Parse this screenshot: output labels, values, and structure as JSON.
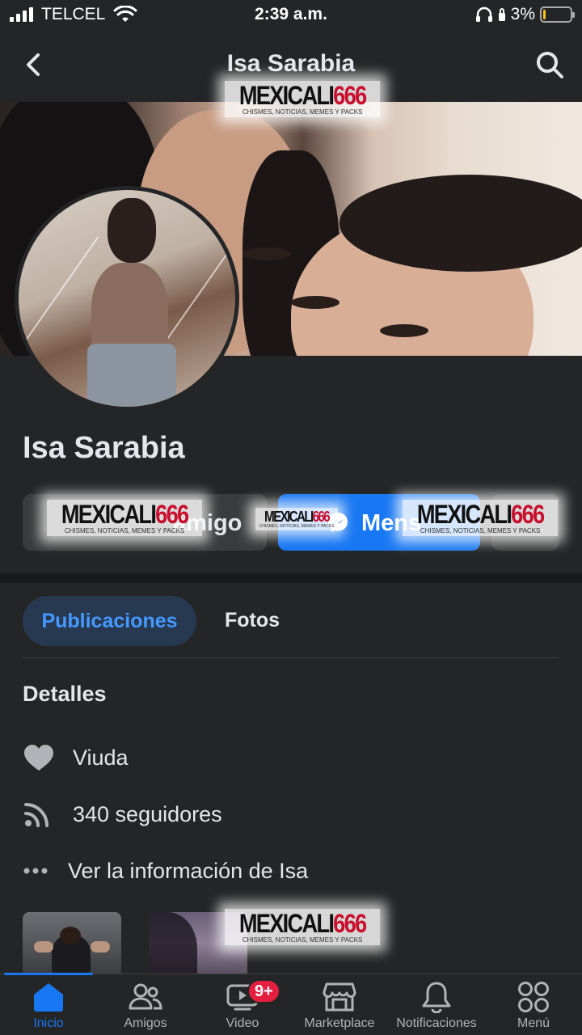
{
  "status_bar": {
    "carrier": "TELCEL",
    "time": "2:39 a.m.",
    "battery_percent_label": "3%",
    "battery_level": 0.03
  },
  "header": {
    "title": "Isa Sarabia",
    "back_icon": "chevron-left-icon",
    "search_icon": "search-icon"
  },
  "watermark": {
    "brand": "MEXICALI",
    "number": "666",
    "tagline": "CHISMES, NOTICIAS, MEMES Y PACKS"
  },
  "profile": {
    "name": "Isa Sarabia"
  },
  "actions": {
    "friend_label_visible": "amigo",
    "message_label_visible": "Mens",
    "accent": "#1877f2"
  },
  "tabs": {
    "items": [
      {
        "label": "Publicaciones",
        "active": true
      },
      {
        "label": "Fotos",
        "active": false
      }
    ]
  },
  "details": {
    "title": "Detalles",
    "rows": [
      {
        "icon": "heart-icon",
        "text": "Viuda"
      },
      {
        "icon": "rss-icon",
        "text": "340 seguidores"
      },
      {
        "icon": "more-dots-icon",
        "text": "Ver la información de Isa"
      }
    ]
  },
  "bottom_nav": {
    "items": [
      {
        "label": "Inicio",
        "icon": "home-icon",
        "active": true
      },
      {
        "label": "Amigos",
        "icon": "friends-icon",
        "active": false
      },
      {
        "label": "Video",
        "icon": "video-icon",
        "badge": "9+",
        "active": false
      },
      {
        "label": "Marketplace",
        "icon": "marketplace-icon",
        "active": false
      },
      {
        "label": "Notificaciones",
        "icon": "bell-icon",
        "active": false
      },
      {
        "label": "Menú",
        "icon": "menu-grid-icon",
        "active": false
      }
    ]
  }
}
